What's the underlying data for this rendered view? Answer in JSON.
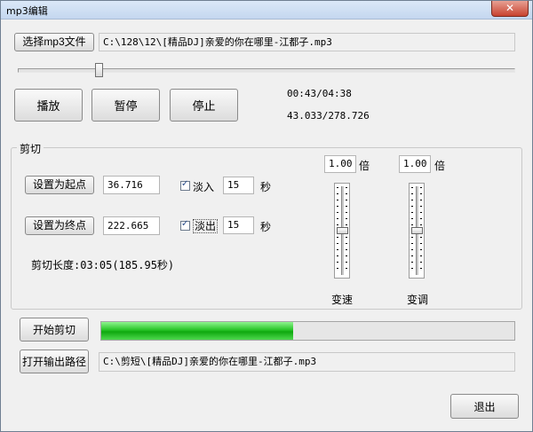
{
  "window": {
    "title": "mp3编辑",
    "close_glyph": "✕"
  },
  "file": {
    "select_label": "选择mp3文件",
    "input_path": "C:\\128\\12\\[精品DJ]亲爱的你在哪里-江都子.mp3"
  },
  "seek": {
    "position_fraction": 0.158
  },
  "playback": {
    "play_label": "播放",
    "pause_label": "暂停",
    "stop_label": "停止",
    "time_text": "00:43/04:38",
    "seconds_text": "43.033/278.726"
  },
  "cut": {
    "group_label": "剪切",
    "set_start_label": "设置为起点",
    "start_value": "36.716",
    "fade_in_label": "淡入",
    "fade_in_checked": true,
    "fade_in_value": "15",
    "set_end_label": "设置为终点",
    "end_value": "222.665",
    "fade_out_label": "淡出",
    "fade_out_checked": true,
    "fade_out_value": "15",
    "seconds_unit": "秒",
    "length_text": "剪切长度:03:05(185.95秒)",
    "speed_value": "1.00",
    "speed_unit": "倍",
    "speed_label": "变速",
    "speed_level": 0.5,
    "pitch_value": "1.00",
    "pitch_unit": "倍",
    "pitch_label": "变调",
    "pitch_level": 0.5
  },
  "process": {
    "start_label": "开始剪切",
    "progress_fraction": 0.465
  },
  "output": {
    "open_label": "打开输出路径",
    "output_path": "C:\\剪短\\[精品DJ]亲爱的你在哪里-江都子.mp3"
  },
  "exit_label": "退出",
  "colors": {
    "progress_fill": "#27c427",
    "window_bg": "#f0f0f0"
  }
}
